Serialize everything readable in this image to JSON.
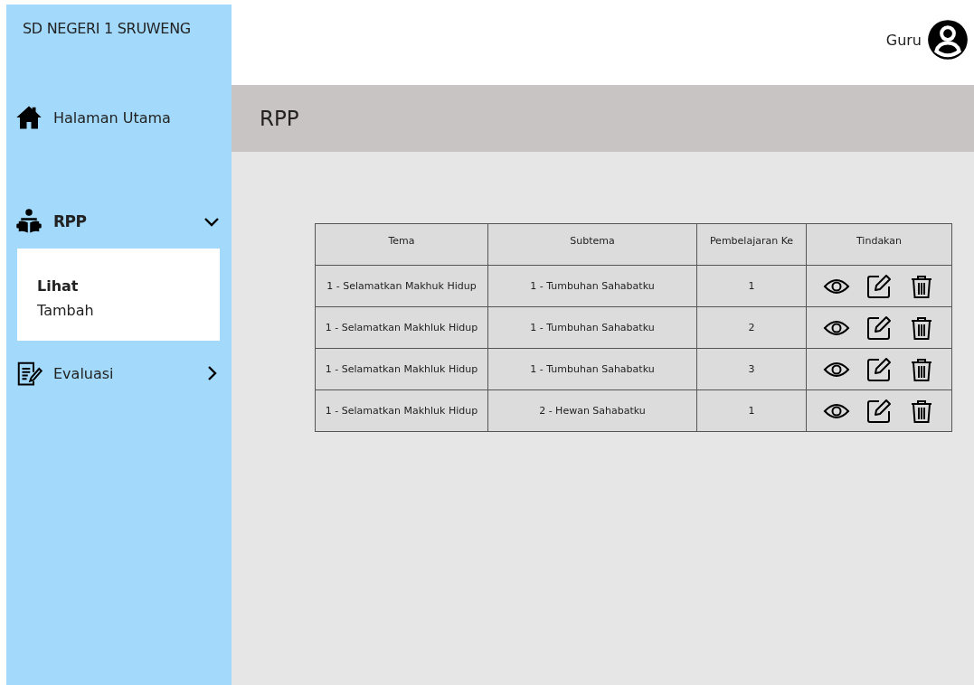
{
  "sidebar": {
    "school": "SD NEGERI 1 SRUWENG",
    "items": [
      {
        "kind": "link",
        "label": "Halaman Utama"
      },
      {
        "kind": "group",
        "label": "RPP",
        "expanded": true,
        "children": [
          {
            "label": "Lihat",
            "selected": true
          },
          {
            "label": "Tambah",
            "selected": false
          }
        ]
      },
      {
        "kind": "group",
        "label": "Evaluasi",
        "expanded": false
      }
    ]
  },
  "header": {
    "user": "Guru"
  },
  "page_title": "RPP",
  "table": {
    "columns": [
      "Tema",
      "Subtema",
      "Pembelajaran Ke",
      "Tindakan"
    ],
    "rows": [
      {
        "tema": "1 - Selamatkan Makhuk Hidup",
        "subtema": "1 - Tumbuhan Sahabatku",
        "ke": "1"
      },
      {
        "tema": "1 - Selamatkan Makhluk Hidup",
        "subtema": "1 - Tumbuhan Sahabatku",
        "ke": "2"
      },
      {
        "tema": "1 - Selamatkan Makhluk Hidup",
        "subtema": "1 - Tumbuhan Sahabatku",
        "ke": "3"
      },
      {
        "tema": "1 - Selamatkan Makhluk Hidup",
        "subtema": "2 - Hewan Sahabatku",
        "ke": "1"
      }
    ]
  }
}
